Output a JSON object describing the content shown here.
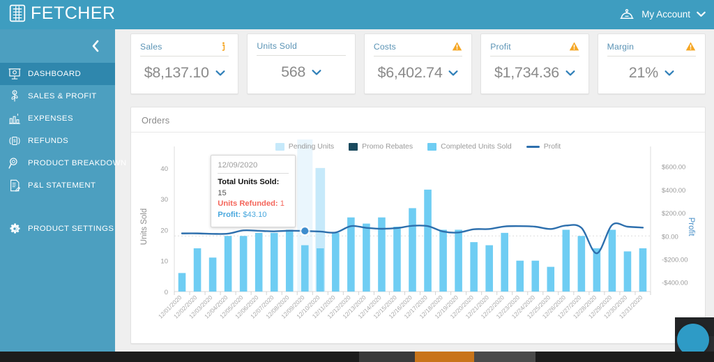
{
  "app": {
    "brand": "FETCHER",
    "brand_icon": "calculator-icon"
  },
  "header": {
    "account_label": "My Account",
    "account_icon": "service-bell-icon",
    "caret_icon": "chevron-down-icon"
  },
  "sidebar": {
    "collapse_icon": "chevron-left-icon",
    "items": [
      {
        "label": "DASHBOARD",
        "icon": "presentation-board-icon",
        "active": true
      },
      {
        "label": "SALES & PROFIT",
        "icon": "money-plant-icon",
        "active": false
      },
      {
        "label": "EXPENSES",
        "icon": "bar-chart-icon",
        "active": false
      },
      {
        "label": "REFUNDS",
        "icon": "money-return-icon",
        "active": false
      },
      {
        "label": "PRODUCT BREAKDOWN",
        "icon": "magnifier-icon",
        "active": false
      },
      {
        "label": "P&L STATEMENT",
        "icon": "document-pen-icon",
        "active": false
      }
    ],
    "footer_items": [
      {
        "label": "PRODUCT SETTINGS",
        "icon": "gear-icon"
      }
    ]
  },
  "kpis": [
    {
      "title": "Sales",
      "value": "$8,137.10",
      "badge": "info-icon",
      "badge_color": "#f5a623"
    },
    {
      "title": "Units Sold",
      "value": "568",
      "badge": "none",
      "badge_color": "#f5a623"
    },
    {
      "title": "Costs",
      "value": "$6,402.74",
      "badge": "warning-icon",
      "badge_color": "#f5a623"
    },
    {
      "title": "Profit",
      "value": "$1,734.36",
      "badge": "warning-icon",
      "badge_color": "#f5a623"
    },
    {
      "title": "Margin",
      "value": "21%",
      "badge": "warning-icon",
      "badge_color": "#f5a623"
    }
  ],
  "panel": {
    "title": "Orders"
  },
  "tooltip": {
    "date": "12/09/2020",
    "total_label": "Total Units Sold:",
    "total_value": "15",
    "refunded_label": "Units Refunded:",
    "refunded_value": "1",
    "profit_label": "Profit:",
    "profit_value": "$43.10"
  },
  "colors": {
    "brand_blue": "#3e9dc0",
    "sidebar_blue": "#4c9fc0",
    "sidebar_active": "#2f87ad",
    "bar_completed": "#6fcdf3",
    "bar_pending": "#c6e9fa",
    "bar_promo": "#1a4a5e",
    "profit_line": "#2d6fad",
    "warning_orange": "#f5a623",
    "refund_red": "#f4665b"
  },
  "chart_data": {
    "type": "bar",
    "title": "Orders",
    "xlabel": "",
    "ylabel": "Units Sold",
    "y2label": "Profit",
    "ylim": [
      0,
      42
    ],
    "y2lim": [
      -480,
      640
    ],
    "yticks": [
      0,
      10,
      20,
      30,
      40
    ],
    "ytick_labels": [
      "0",
      "10",
      "20",
      "30",
      "40"
    ],
    "y2ticks": [
      -400,
      -200,
      0,
      200,
      400,
      600
    ],
    "y2tick_labels": [
      "-$400.00",
      "-$200.00",
      "$0.00",
      "$200.00",
      "$400.00",
      "$600.00"
    ],
    "grid": false,
    "legend_position": "top-center",
    "legend": [
      "Pending Units",
      "Promo Rebates",
      "Completed Units Sold",
      "Profit"
    ],
    "categories": [
      "12/01/2020",
      "12/02/2020",
      "12/03/2020",
      "12/04/2020",
      "12/05/2020",
      "12/06/2020",
      "12/07/2020",
      "12/08/2020",
      "12/09/2020",
      "12/10/2020",
      "12/11/2020",
      "12/12/2020",
      "12/13/2020",
      "12/14/2020",
      "12/15/2020",
      "12/16/2020",
      "12/17/2020",
      "12/18/2020",
      "12/19/2020",
      "12/20/2020",
      "12/21/2020",
      "12/22/2020",
      "12/23/2020",
      "12/24/2020",
      "12/25/2020",
      "12/26/2020",
      "12/27/2020",
      "12/28/2020",
      "12/29/2020",
      "12/30/2020",
      "12/31/2020"
    ],
    "series": [
      {
        "name": "Completed Units Sold",
        "color": "#6fcdf3",
        "axis": "left",
        "values": [
          6,
          14,
          11,
          18,
          18,
          19,
          19,
          20,
          15,
          14,
          19,
          24,
          22,
          24,
          21,
          27,
          33,
          20,
          20,
          16,
          15,
          19,
          10,
          10,
          8,
          20,
          18,
          14,
          20,
          13,
          14
        ]
      },
      {
        "name": "Pending Units",
        "color": "#c6e9fa",
        "axis": "left",
        "values": [
          0,
          0,
          0,
          0,
          0,
          0,
          0,
          0,
          0,
          40,
          0,
          0,
          0,
          0,
          0,
          0,
          0,
          0,
          0,
          0,
          0,
          0,
          0,
          0,
          0,
          0,
          0,
          0,
          0,
          0,
          0
        ]
      },
      {
        "name": "Promo Rebates",
        "color": "#1a4a5e",
        "axis": "left",
        "values": [
          0,
          0,
          0,
          0,
          0,
          0,
          0,
          0,
          0,
          0,
          0,
          0,
          0,
          0,
          0,
          0,
          0,
          0,
          0,
          0,
          0,
          0,
          0,
          0,
          0,
          0,
          0,
          0,
          0,
          0,
          0
        ]
      },
      {
        "name": "Profit",
        "type": "line",
        "color": "#2d6fad",
        "axis": "right",
        "values": [
          22,
          22,
          18,
          20,
          48,
          44,
          40,
          45,
          43,
          38,
          30,
          85,
          70,
          62,
          68,
          88,
          85,
          38,
          30,
          58,
          60,
          82,
          85,
          80,
          60,
          90,
          70,
          -150,
          95,
          80,
          72
        ]
      }
    ],
    "highlight": {
      "category": "12/09/2020",
      "index": 8
    },
    "annotations": [
      {
        "type": "tooltip",
        "category": "12/09/2020",
        "lines": [
          "Total Units Sold: 15",
          "Units Refunded: 1",
          "Profit: $43.10"
        ]
      }
    ]
  }
}
